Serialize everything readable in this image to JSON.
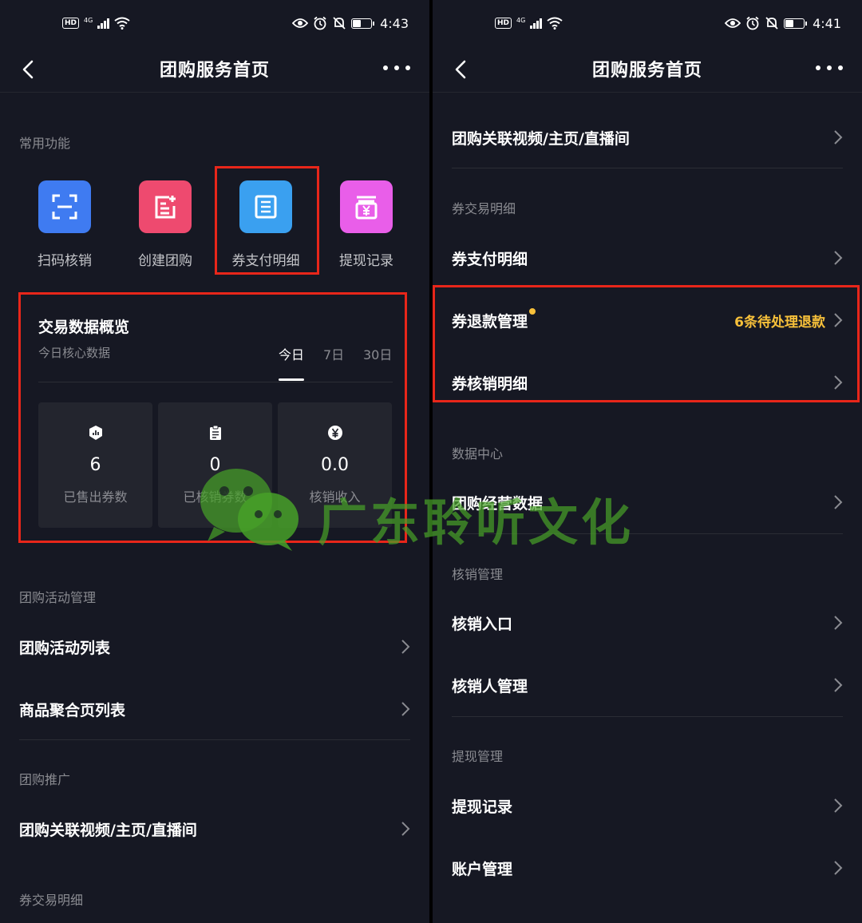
{
  "status_left": {
    "time": "4:43",
    "net": "4G"
  },
  "status_right": {
    "time": "4:41",
    "net": "4G"
  },
  "nav": {
    "title": "团购服务首页"
  },
  "left": {
    "common_label": "常用功能",
    "quick_items": [
      {
        "label": "扫码核销",
        "icon": "scan-icon",
        "color": "#3f7bf1"
      },
      {
        "label": "创建团购",
        "icon": "create-doc-icon",
        "color": "#ee4a6f"
      },
      {
        "label": "券支付明细",
        "icon": "list-doc-icon",
        "color": "#3aa0f0"
      },
      {
        "label": "提现记录",
        "icon": "yuan-wallet-icon",
        "color": "#e95ee9"
      }
    ],
    "overview": {
      "title": "交易数据概览",
      "subtitle": "今日核心数据",
      "tabs": [
        "今日",
        "7日",
        "30日"
      ],
      "stats": [
        {
          "value": "6",
          "label": "已售出券数",
          "icon": "chart-shield-icon"
        },
        {
          "value": "0",
          "label": "已核销券数",
          "icon": "clipboard-icon"
        },
        {
          "value": "0.0",
          "label": "核销收入",
          "icon": "yuan-circle-icon"
        }
      ]
    },
    "activity_label": "团购活动管理",
    "activity_rows": [
      "团购活动列表",
      "商品聚合页列表"
    ],
    "promo_label": "团购推广",
    "promo_rows": [
      "团购关联视频/主页/直播间"
    ],
    "coupon_label": "券交易明细"
  },
  "right": {
    "top_row": "团购关联视频/主页/直播间",
    "coupon_label": "券交易明细",
    "coupon_rows": [
      "券支付明细",
      "券退款管理",
      "券核销明细"
    ],
    "refund_pending": "6条待处理退款",
    "data_label": "数据中心",
    "data_rows": [
      "团购经营数据"
    ],
    "verify_label": "核销管理",
    "verify_rows": [
      "核销入口",
      "核销人管理"
    ],
    "withdraw_label": "提现管理",
    "withdraw_rows": [
      "提现记录",
      "账户管理"
    ]
  },
  "watermark": {
    "text": "广东聆听文化"
  },
  "colors": {
    "background": "#161823",
    "highlight": "#e8261a",
    "accent_yellow": "#f7c03a",
    "watermark": "#46a028"
  }
}
